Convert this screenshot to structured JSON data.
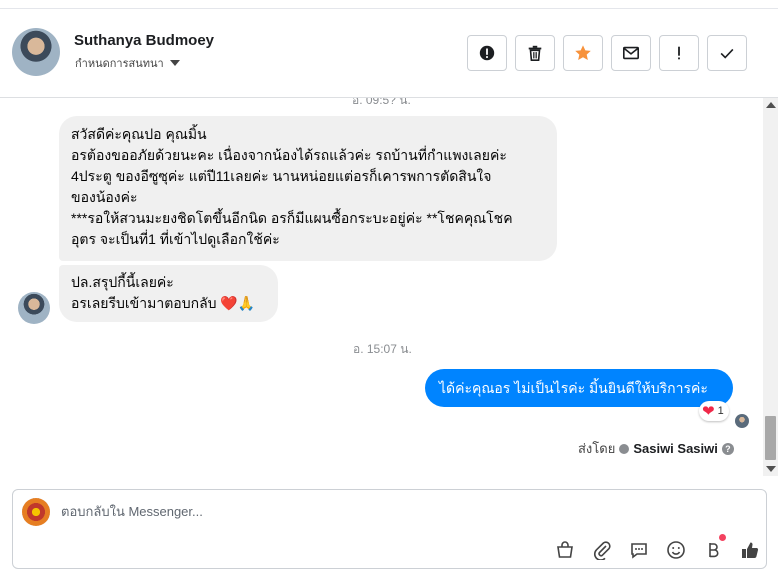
{
  "header": {
    "name": "Suthanya Budmoey",
    "subtitle": "กำหนดการสนทนา",
    "actions": [
      {
        "icon": "alert-circle-icon",
        "name": "spam-button"
      },
      {
        "icon": "trash-icon",
        "name": "delete-button"
      },
      {
        "icon": "star-icon",
        "name": "star-button"
      },
      {
        "icon": "envelope-icon",
        "name": "mark-unread-button"
      },
      {
        "icon": "exclamation-icon",
        "name": "follow-up-button"
      },
      {
        "icon": "check-icon",
        "name": "done-button"
      }
    ],
    "star_color": "#f7923b"
  },
  "thread": {
    "timestamp_top": "อ. 09:5? น.",
    "message1_lines": [
      "สวัสดีค่ะคุณปอ คุณมิ้น",
      "อรต้องขออภัยด้วยนะคะ เนื่องจากน้องได้รถแล้วค่ะ รถบ้านที่กำแพงเลยค่ะ",
      "4ประตู ของอีซูซุค่ะ แต่ปี11เลยค่ะ นานหน่อยแต่อรก็เคารพการตัดสินใจ",
      "ของน้องค่ะ",
      "***รอให้สวนมะยงชิดโตขึ้นอีกนิด อรก็มีแผนซื้อกระบะอยู่ค่ะ  **โชคคุณโชค",
      "อุตร จะเป็นที่1 ที่เข้าไปดูเลือกใช้ค่ะ"
    ],
    "message2_lines": [
      "ปล.สรุปกี้นี้เลยค่ะ",
      "อรเลยรีบเข้ามาตอบกลับ ❤️🙏"
    ],
    "timestamp_mid": "อ. 15:07 น.",
    "reply": "ได้ค่ะคุณอร ไม่เป็นไรค่ะ มิ้นยินดีให้บริการค่ะ",
    "reply_color": "#0084ff",
    "reaction_count": "1",
    "sent_by_label": "ส่งโดย",
    "sent_by_name": "Sasiwi Sasiwi"
  },
  "composer": {
    "placeholder": "ตอบกลับใน Messenger...",
    "tools": [
      "shopping-bag-icon",
      "paperclip-icon",
      "speech-bubble-icon",
      "smiley-icon",
      "baht-icon",
      "thumbs-up-icon"
    ]
  }
}
